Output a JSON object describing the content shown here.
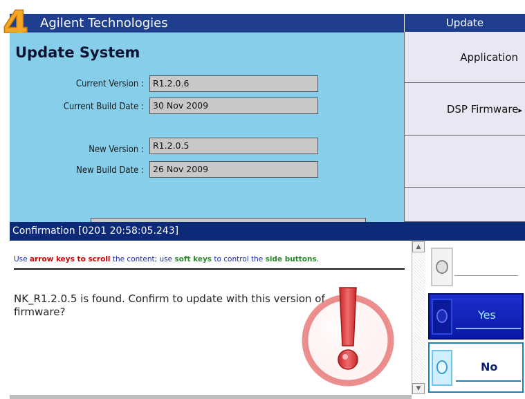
{
  "header": {
    "brand": "Agilent Technologies",
    "logo_glyph": "4"
  },
  "main": {
    "title": "Update System",
    "fields": [
      {
        "label": "Current Version :",
        "value": "R1.2.0.6"
      },
      {
        "label": "Current Build Date :",
        "value": "30 Nov 2009"
      },
      {
        "label": "New Version :",
        "value": "R1.2.0.5"
      },
      {
        "label": "New Build Date :",
        "value": "26 Nov 2009"
      }
    ]
  },
  "softkeys": {
    "header": "Update",
    "items": [
      {
        "label": "Application"
      },
      {
        "label": "DSP Firmware"
      },
      {
        "label": ""
      },
      {
        "label": ""
      }
    ],
    "submenu_arrow": "▸"
  },
  "dialog": {
    "title": "Confirmation [0201 20:58:05.243]",
    "instruction": {
      "p1": "Use ",
      "p2": "arrow keys to scroll",
      "p3": " the content; use ",
      "p4": "soft keys",
      "p5": " to control the ",
      "p6": "side buttons",
      "p7": "."
    },
    "message": "NK_R1.2.0.5 is found. Confirm to update with this version of firmware?",
    "buttons": {
      "yes": "Yes",
      "no": "No"
    },
    "icon": "warning-exclamation-icon"
  },
  "colors": {
    "header_bg": "#1f3f8e",
    "panel_bg": "#87ceeb",
    "dialog_title_bg": "#0c2a78",
    "yes_bg": "#1c2ecc",
    "logo_orange": "#f5a623",
    "warning_red": "#e04545"
  }
}
